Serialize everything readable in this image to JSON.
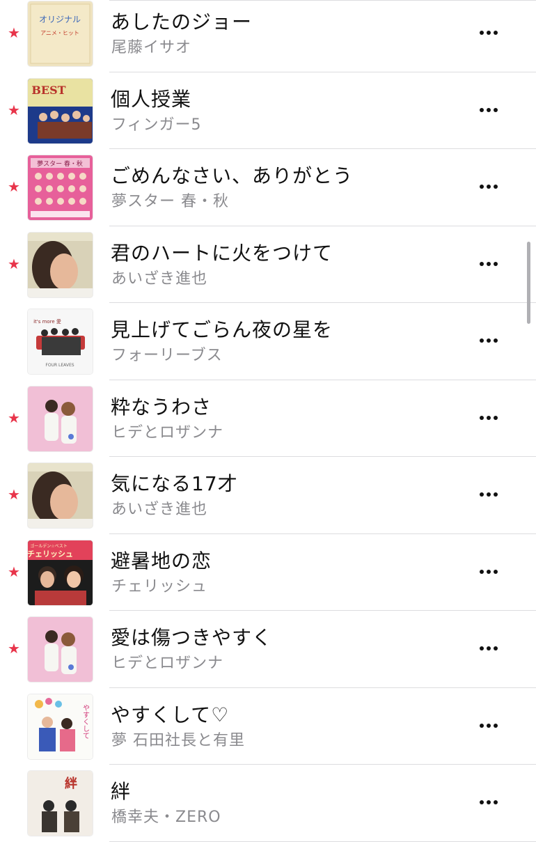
{
  "tracks": [
    {
      "title": "あしたのジョー",
      "artist": "尾藤イサオ",
      "favorite": true,
      "art": "art-original"
    },
    {
      "title": "個人授業",
      "artist": "フィンガー5",
      "favorite": true,
      "art": "art-best"
    },
    {
      "title": "ごめんなさい、ありがとう",
      "artist": "夢スター 春・秋",
      "favorite": true,
      "art": "art-yumestar"
    },
    {
      "title": "君のハートに火をつけて",
      "artist": "あいざき進也",
      "favorite": true,
      "art": "art-portrait"
    },
    {
      "title": "見上げてごらん夜の星を",
      "artist": "フォーリーブス",
      "favorite": false,
      "art": "art-group"
    },
    {
      "title": "粋なうわさ",
      "artist": "ヒデとロザンナ",
      "favorite": true,
      "art": "art-couple"
    },
    {
      "title": "気になる17才",
      "artist": "あいざき進也",
      "favorite": true,
      "art": "art-portrait"
    },
    {
      "title": "避暑地の恋",
      "artist": "チェリッシュ",
      "favorite": true,
      "art": "art-cherish"
    },
    {
      "title": "愛は傷つきやすく",
      "artist": "ヒデとロザンナ",
      "favorite": true,
      "art": "art-couple"
    },
    {
      "title": "やすくして♡",
      "artist": "夢 石田社長と有里",
      "favorite": false,
      "art": "art-yasuku"
    },
    {
      "title": "絆",
      "artist": "橋幸夫・ZERO",
      "favorite": false,
      "art": "art-kizuna"
    }
  ],
  "art_text": {
    "original_top": "オリジナル",
    "original_bottom": "アニメ・ヒット",
    "best": "BEST",
    "yumestar": "夢スター 春・秋",
    "group_top": "it's more 愛",
    "group_bottom": "FOUR LEAVES",
    "cherish_top": "ゴールデン☆ベスト",
    "cherish_title": "チェリッシュ",
    "yasuku": "やすくして",
    "kizuna": "絆"
  },
  "colors": {
    "favorite_star": "#e8344a",
    "title": "#111111",
    "subtitle": "#8a8a8e",
    "separator": "#dcdcdf"
  },
  "icons": {
    "favorite": "star-icon",
    "more": "more-options-icon"
  }
}
